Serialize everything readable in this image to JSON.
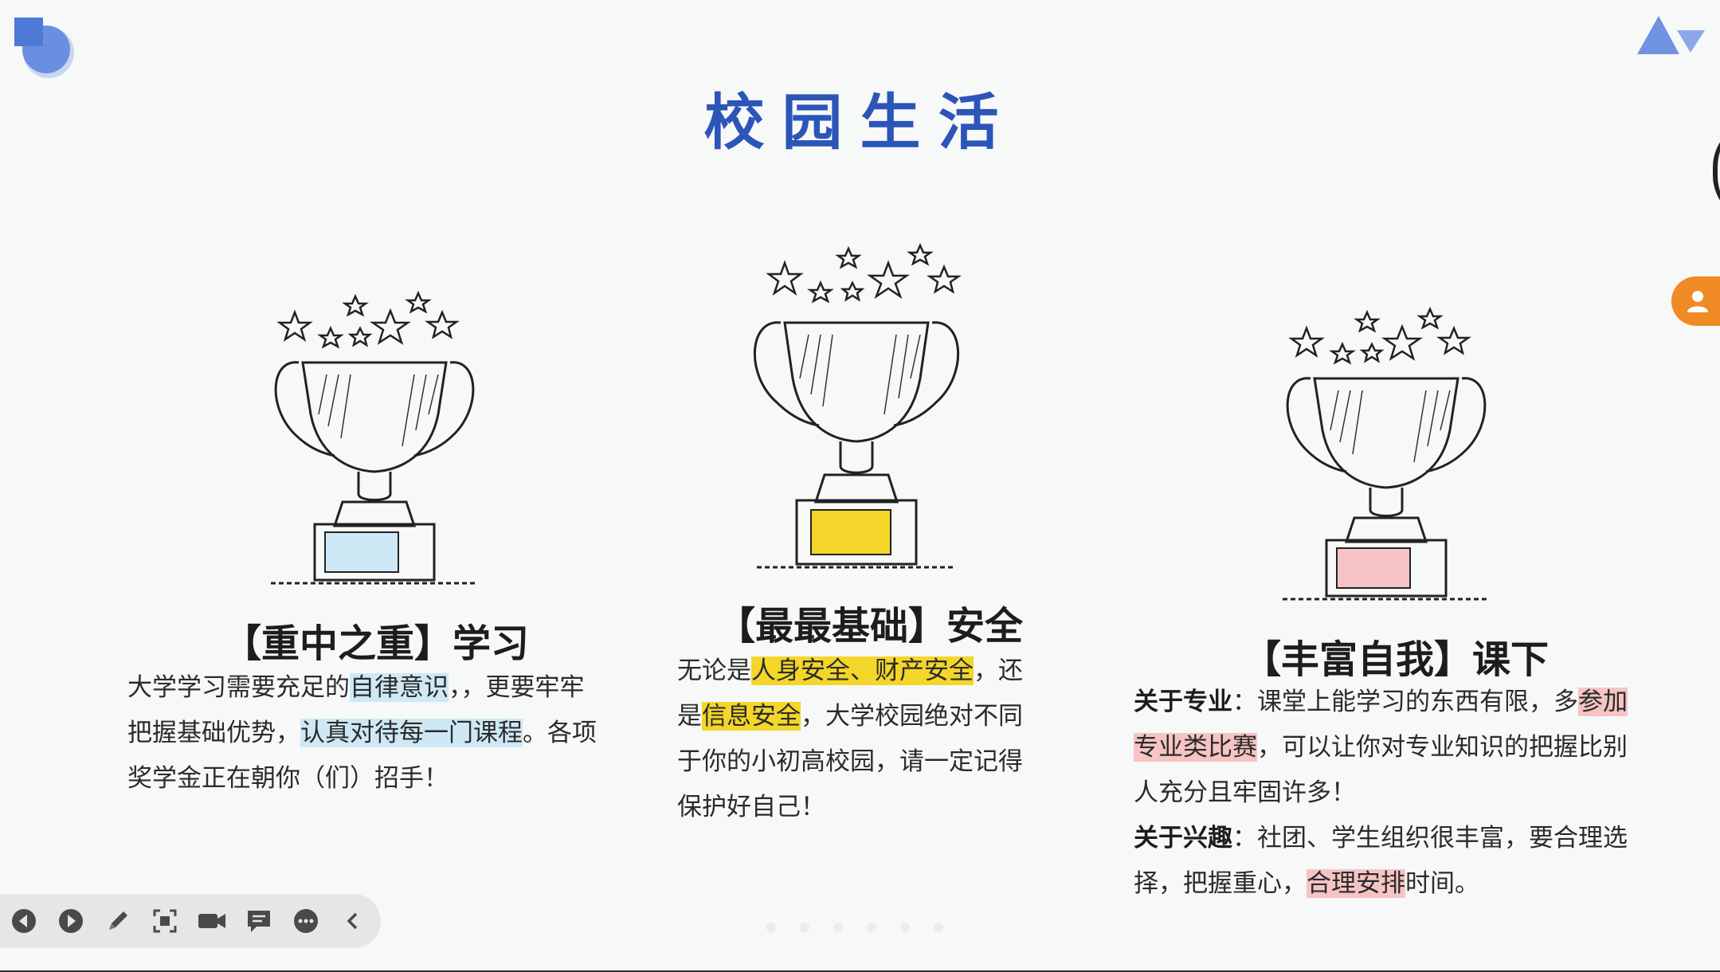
{
  "slide": {
    "title": "校园生活",
    "columns": [
      {
        "heading": "【重中之重】学习",
        "badge_color": "#cfe8f5",
        "paragraph": [
          {
            "text": "大学学习需要充足的",
            "style": "plain"
          },
          {
            "text": "自律意识",
            "style": "hl-blue"
          },
          {
            "text": "，，更要牢牢把握基础优势，",
            "style": "plain"
          },
          {
            "text": "认真对待每一门课程",
            "style": "hl-blue"
          },
          {
            "text": "。各项奖学金正在朝你（们）招手！",
            "style": "plain"
          }
        ]
      },
      {
        "heading": "【最最基础】安全",
        "badge_color": "#f3d629",
        "paragraph": [
          {
            "text": "无论是",
            "style": "plain"
          },
          {
            "text": "人身安全、财产安全",
            "style": "hl-yellow"
          },
          {
            "text": "，还是",
            "style": "plain"
          },
          {
            "text": "信息安全",
            "style": "hl-yellow"
          },
          {
            "text": "，大学校园绝对不同于你的小初高校园，请一定记得保护好自己！",
            "style": "plain"
          }
        ]
      },
      {
        "heading": "【丰富自我】课下",
        "badge_color": "#f6c4c4",
        "paragraph": [
          {
            "text": "关于专业",
            "style": "bold"
          },
          {
            "text": "：课堂上能学习的东西有限，多",
            "style": "plain"
          },
          {
            "text": "参加专业类比赛",
            "style": "hl-pink"
          },
          {
            "text": "，可以让你对专业知识的把握比别人充分且牢固许多！",
            "style": "plain"
          },
          {
            "text": "关于兴趣",
            "style": "bold-break"
          },
          {
            "text": "：社团、学生组织很丰富，要合理选择，把握重心，",
            "style": "plain"
          },
          {
            "text": "合理安排",
            "style": "hl-pink"
          },
          {
            "text": "时间。",
            "style": "plain"
          }
        ]
      }
    ]
  },
  "toolbar": {
    "buttons": [
      {
        "name": "previous-slide-button",
        "icon": "play-left-icon"
      },
      {
        "name": "next-slide-button",
        "icon": "play-right-icon"
      },
      {
        "name": "pen-button",
        "icon": "pen-icon"
      },
      {
        "name": "screenshot-button",
        "icon": "screenshot-icon"
      },
      {
        "name": "camera-button",
        "icon": "camera-icon"
      },
      {
        "name": "comment-button",
        "icon": "comment-icon"
      },
      {
        "name": "more-button",
        "icon": "more-icon"
      },
      {
        "name": "collapse-button",
        "icon": "chevron-left-icon"
      }
    ]
  },
  "pagination": {
    "count": 6,
    "active_index": 0
  },
  "colors": {
    "title": "#2c55b8",
    "accent_orange": "#f08a24",
    "deco_blue": "#6b8fe0"
  }
}
